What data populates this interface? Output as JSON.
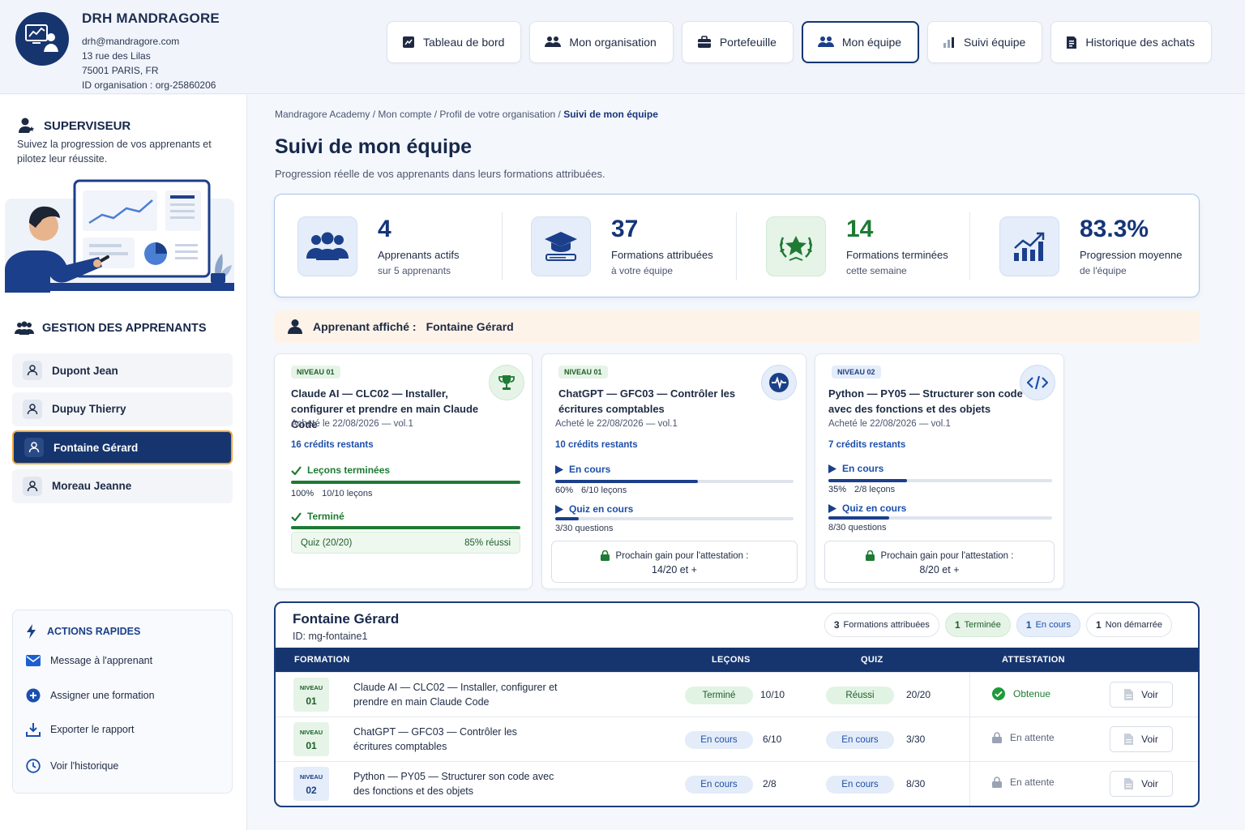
{
  "org": {
    "name": "DRH MANDRAGORE",
    "email": "drh@mandragore.com",
    "address1": "13 rue des Lilas",
    "address2": "75001 PARIS, FR",
    "org_id": "ID organisation : org-25860206"
  },
  "nav": [
    {
      "label": "Tableau de bord",
      "icon": "dashboard-icon"
    },
    {
      "label": "Mon organisation",
      "icon": "users-icon"
    },
    {
      "label": "Portefeuille",
      "icon": "briefcase-icon"
    },
    {
      "label": "Mon équipe",
      "icon": "team-icon",
      "active": true
    },
    {
      "label": "Suivi équipe",
      "icon": "bar-chart-icon"
    },
    {
      "label": "Historique des achats",
      "icon": "receipt-icon"
    }
  ],
  "sidebar": {
    "supervisor_title": "SUPERVISEUR",
    "supervisor_desc": "Suivez la progression de vos apprenants et pilotez leur réussite.",
    "learners_title": "GESTION DES APPRENANTS",
    "learners": [
      {
        "name": "Dupont Jean"
      },
      {
        "name": "Dupuy Thierry"
      },
      {
        "name": "Fontaine Gérard",
        "selected": true
      },
      {
        "name": "Moreau Jeanne"
      }
    ],
    "quick_title": "ACTIONS RAPIDES",
    "quick_actions": [
      {
        "label": "Message à l'apprenant",
        "icon": "mail-icon"
      },
      {
        "label": "Assigner une formation",
        "icon": "plus-circle-icon"
      },
      {
        "label": "Exporter le rapport",
        "icon": "download-icon"
      },
      {
        "label": "Voir l'historique",
        "icon": "clock-icon"
      }
    ]
  },
  "breadcrumb": {
    "path": "Mandragore Academy / Mon compte / Profil de votre organisation / ",
    "current": "Suivi de mon équipe"
  },
  "page": {
    "title": "Suivi de mon équipe",
    "subtitle": "Progression réelle de vos apprenants dans leurs formations attribuées."
  },
  "stats": [
    {
      "value": "4",
      "label": "Apprenants actifs",
      "sub": "sur 5 apprenants",
      "icon": "group-icon"
    },
    {
      "value": "37",
      "label": "Formations attribuées",
      "sub": "à votre équipe",
      "icon": "graduation-cap-icon"
    },
    {
      "value": "14",
      "label": "Formations terminées",
      "sub": "cette semaine",
      "icon": "laurel-star-icon"
    },
    {
      "value": "83.3%",
      "label": "Progression moyenne",
      "sub": "de l'équipe",
      "icon": "growth-chart-icon"
    }
  ],
  "banner": {
    "label": "Apprenant affiché :",
    "name": "Fontaine Gérard"
  },
  "cards": [
    {
      "level": "NIVEAU 01",
      "title": "Claude AI — CLC02 — Installer, configurer et prendre en main Claude Code",
      "bought": "Acheté le 22/08/2026 — vol.1",
      "credits": "16 crédits restants",
      "status1": "Leçons terminées",
      "progress1": 1.0,
      "pct1": "100%",
      "meta1": "10/10 leçons",
      "status2": "Terminé",
      "progress2": 1.0,
      "quiz_label": "Quiz (20/20)",
      "quiz_result": "85% réussi",
      "icon": "trophy-icon"
    },
    {
      "level": "NIVEAU 01",
      "title": "ChatGPT — GFC03 — Contrôler les écritures comptables",
      "bought": "Acheté le 22/08/2026 — vol.1",
      "credits": "10 crédits restants",
      "status1": "En cours",
      "progress1": 0.6,
      "pct1": "60%",
      "meta1": "6/10 leçons",
      "status2": "Quiz en cours",
      "progress2": 0.1,
      "meta2": "3/30 questions",
      "gain_label": "Prochain gain pour l'attestation :",
      "gain_value": "14/20 et +",
      "icon": "pulse-icon"
    },
    {
      "level": "NIVEAU 02",
      "title": "Python — PY05 — Structurer son code avec des fonctions et des objets",
      "bought": "Acheté le 22/08/2026 — vol.1",
      "credits": "7 crédits restants",
      "status1": "En cours",
      "progress1": 0.35,
      "pct1": "35%",
      "meta1": "2/8 leçons",
      "status2": "Quiz en cours",
      "progress2": 0.27,
      "meta2": "8/30 questions",
      "gain_label": "Prochain gain pour l'attestation :",
      "gain_value": "8/20 et +",
      "icon": "code-icon"
    }
  ],
  "table": {
    "name": "Fontaine Gérard",
    "id": "ID: mg-fontaine1",
    "pills": [
      {
        "count": "3",
        "label": "Formations attribuées"
      },
      {
        "count": "1",
        "label": "Terminée"
      },
      {
        "count": "1",
        "label": "En cours"
      },
      {
        "count": "1",
        "label": "Non démarrée"
      }
    ],
    "headers": [
      "FORMATION",
      "LEÇONS",
      "QUIZ",
      "ATTESTATION"
    ],
    "rows": [
      {
        "level_word": "NIVEAU",
        "level_num": "01",
        "title": "Claude AI — CLC02 — Installer, configurer et prendre en main Claude Code",
        "lessons_status": "Terminé",
        "lessons": "10/10",
        "quiz_status": "Réussi",
        "quiz": "20/20",
        "attestation": "Obtenue",
        "action": "Voir"
      },
      {
        "level_word": "NIVEAU",
        "level_num": "01",
        "title": "ChatGPT — GFC03 — Contrôler les écritures comptables",
        "lessons_status": "En cours",
        "lessons": "6/10",
        "quiz_status": "En cours",
        "quiz": "3/30",
        "attestation": "En attente",
        "action": "Voir"
      },
      {
        "level_word": "NIVEAU",
        "level_num": "02",
        "title": "Python — PY05 — Structurer son code avec des fonctions et des objets",
        "lessons_status": "En cours",
        "lessons": "2/8",
        "quiz_status": "En cours",
        "quiz": "8/30",
        "attestation": "En attente",
        "action": "Voir"
      }
    ]
  },
  "colors": {
    "primary": "#16356f",
    "accent": "#f2a93b",
    "success": "#1f7a34",
    "info": "#1d4faa"
  }
}
